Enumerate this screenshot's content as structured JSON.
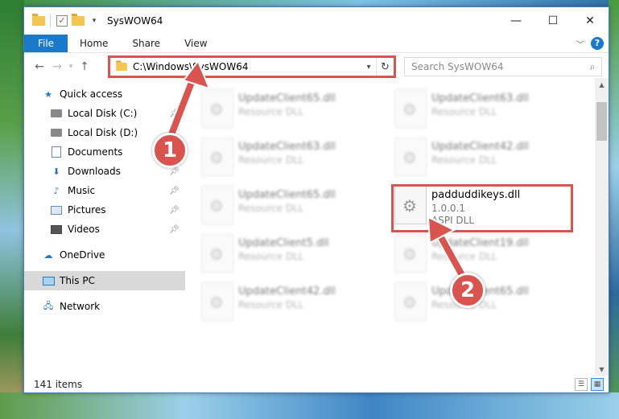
{
  "window": {
    "title": "SysWOW64"
  },
  "window_controls": {
    "minimize": "—",
    "maximize": "☐",
    "close": "✕"
  },
  "ribbon": {
    "file": "File",
    "tabs": [
      "Home",
      "Share",
      "View"
    ],
    "help": "?"
  },
  "address": {
    "path": "C:\\Windows\\SysWOW64"
  },
  "search": {
    "placeholder": "Search SysWOW64"
  },
  "sidebar": {
    "quick_access": "Quick access",
    "items": [
      {
        "label": "Local Disk (C:)",
        "icon": "drive-icon",
        "pinned": true
      },
      {
        "label": "Local Disk (D:)",
        "icon": "drive-icon",
        "pinned": false
      },
      {
        "label": "Documents",
        "icon": "document-icon",
        "pinned": true
      },
      {
        "label": "Downloads",
        "icon": "download-icon",
        "pinned": true
      },
      {
        "label": "Music",
        "icon": "music-icon",
        "pinned": true
      },
      {
        "label": "Pictures",
        "icon": "pictures-icon",
        "pinned": true
      },
      {
        "label": "Videos",
        "icon": "videos-icon",
        "pinned": true
      }
    ],
    "onedrive": "OneDrive",
    "this_pc": "This PC",
    "network": "Network"
  },
  "files": [
    {
      "name": "UpdateClient65.dll",
      "type": "Resource DLL",
      "blurred": true
    },
    {
      "name": "UpdateClient63.dll",
      "type": "Resource DLL",
      "blurred": true
    },
    {
      "name": "UpdateClient63.dll",
      "type": "Resource DLL",
      "blurred": true
    },
    {
      "name": "UpdateClient42.dll",
      "type": "Resource DLL",
      "blurred": true
    },
    {
      "name": "UpdateClient65.dll",
      "type": "Resource DLL",
      "blurred": true
    },
    {
      "name": "padduddikeys.dll",
      "version": "1.0.0.1",
      "type": "ASPI DLL",
      "blurred": false
    },
    {
      "name": "UpdateClient5.dll",
      "type": "Resource DLL",
      "blurred": true
    },
    {
      "name": "UpdateClient19.dll",
      "type": "Resource DLL",
      "blurred": true
    },
    {
      "name": "UpdateClient42.dll",
      "type": "Resource DLL",
      "blurred": true
    },
    {
      "name": "UpdateClient65.dll",
      "type": "Resource DLL",
      "blurred": true
    }
  ],
  "status": {
    "item_count": "141 items"
  },
  "annotations": {
    "step1": "1",
    "step2": "2",
    "color": "#d9534f"
  }
}
